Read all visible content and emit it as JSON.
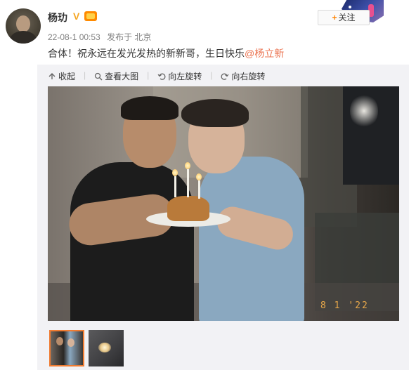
{
  "post": {
    "username": "杨玏",
    "timestamp": "22-08-1 00:53",
    "source": "发布于 北京",
    "text_before_mention": "合体！祝永远在发光发热的新新哥，生日快乐",
    "mention": "@杨立新",
    "follow_label": "关注"
  },
  "toolbar": {
    "collapse": "收起",
    "view_large": "查看大图",
    "rotate_left": "向左旋转",
    "rotate_right": "向右旋转"
  },
  "photo": {
    "date_stamp": "8 1 '22"
  },
  "thumbnails": {
    "count": 2,
    "selected_index": 0
  },
  "colors": {
    "accent": "#ff8200",
    "mention": "#eb7350",
    "selected_thumb_border": "#f07c32",
    "verified": "#f5a623"
  },
  "icons": [
    "avatar",
    "verified-icon",
    "member-icon",
    "plus-icon",
    "collapse-icon",
    "search-icon",
    "rotate-left-icon",
    "rotate-right-icon"
  ]
}
